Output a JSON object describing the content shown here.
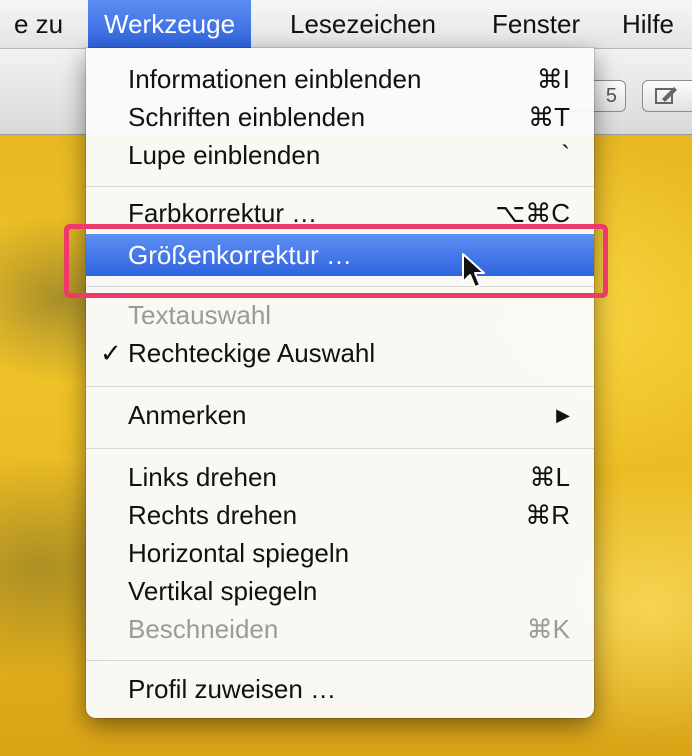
{
  "menubar": {
    "items": [
      {
        "label": "e zu"
      },
      {
        "label": "Werkzeuge",
        "active": true
      },
      {
        "label": "Lesezeichen"
      },
      {
        "label": "Fenster"
      },
      {
        "label": "Hilfe"
      }
    ]
  },
  "toolbar": {
    "btn_partial_label": "5",
    "btn_markup_icon": "pencil-icon"
  },
  "menu": {
    "items": [
      {
        "label": "Informationen einblenden",
        "shortcut": "⌘I"
      },
      {
        "label": "Schriften einblenden",
        "shortcut": "⌘T"
      },
      {
        "label": "Lupe einblenden",
        "shortcut": "`"
      },
      {
        "label": "Farbkorrektur …",
        "shortcut": "⌥⌘C"
      },
      {
        "label": "Größenkorrektur …",
        "shortcut": "",
        "highlighted": true
      },
      {
        "label": "Textauswahl",
        "disabled": true
      },
      {
        "label": "Rechteckige Auswahl",
        "checked": true,
        "check_glyph": "✓"
      },
      {
        "label": "Anmerken",
        "submenu": true,
        "arrow_glyph": "▶"
      },
      {
        "label": "Links drehen",
        "shortcut": "⌘L"
      },
      {
        "label": "Rechts drehen",
        "shortcut": "⌘R"
      },
      {
        "label": "Horizontal spiegeln"
      },
      {
        "label": "Vertikal spiegeln"
      },
      {
        "label": "Beschneiden",
        "shortcut": "⌘K",
        "disabled": true
      },
      {
        "label": "Profil zuweisen …"
      }
    ]
  },
  "colors": {
    "highlight": "#3a6fe6",
    "annotation": "#ee3a6a"
  }
}
